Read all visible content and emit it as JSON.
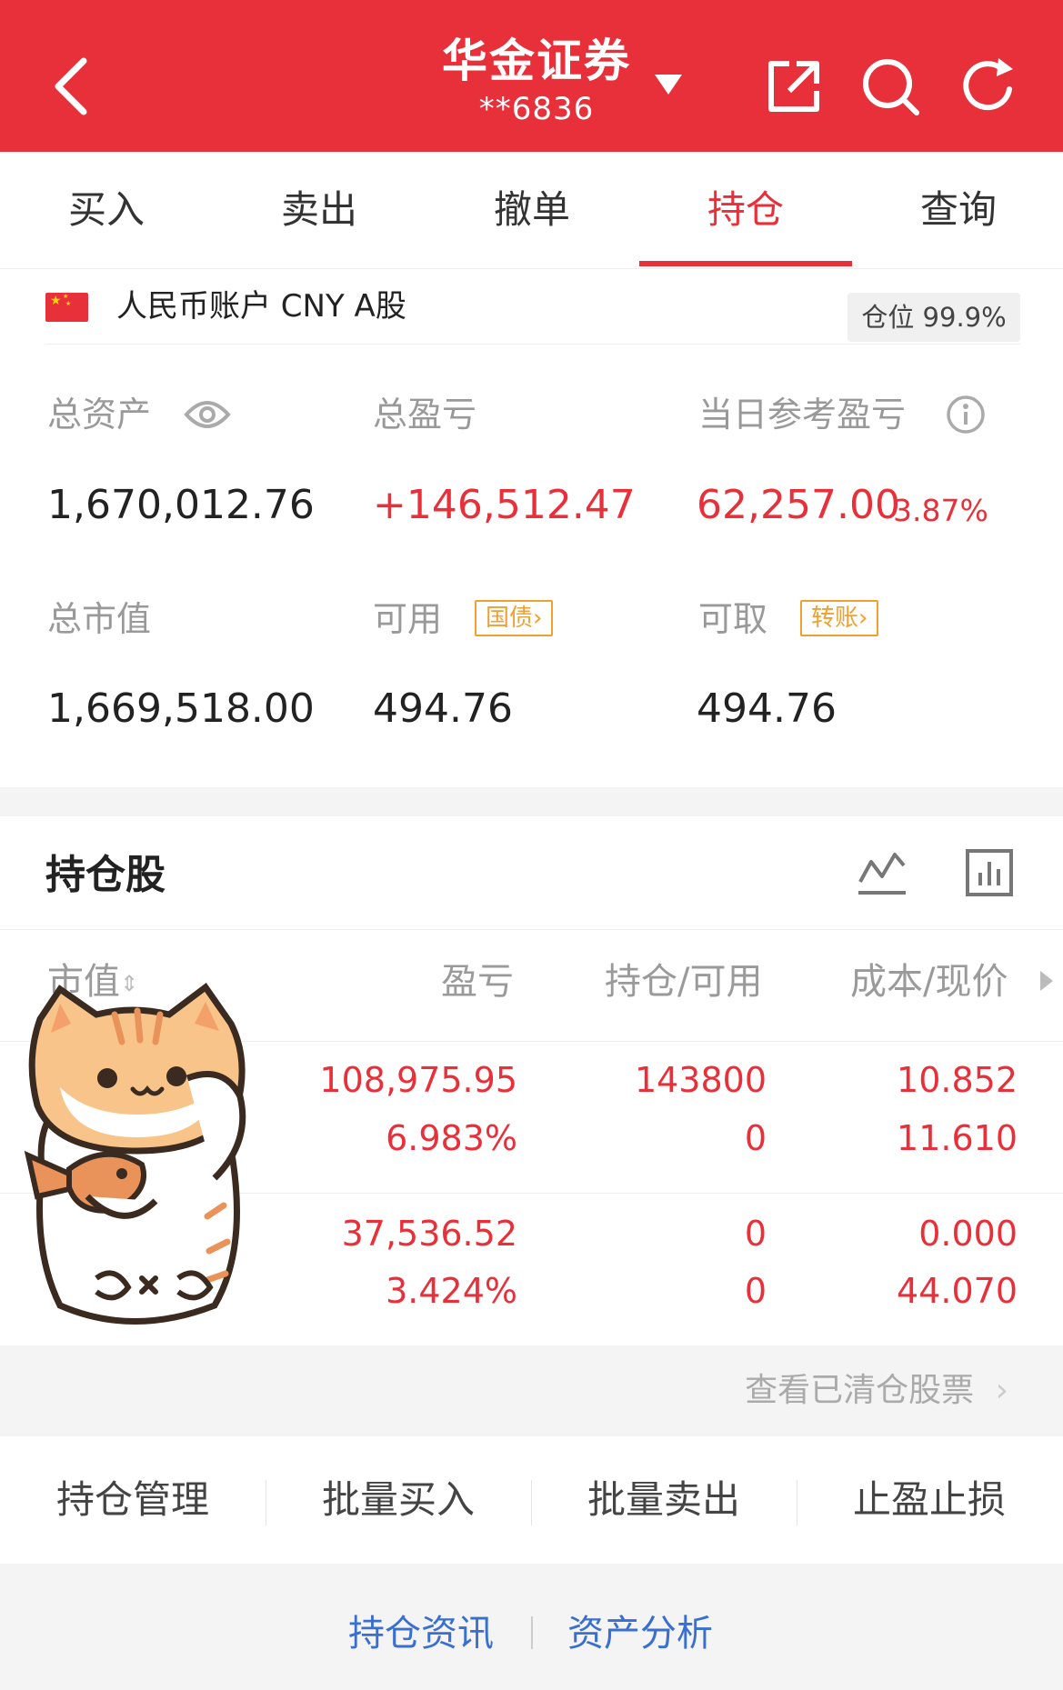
{
  "header": {
    "broker": "华金证券",
    "account_mask": "**6836"
  },
  "tabs": [
    "买入",
    "卖出",
    "撤单",
    "持仓",
    "查询"
  ],
  "active_tab": "持仓",
  "account": {
    "label": "人民币账户 CNY A股",
    "position_label": "仓位",
    "position_value": "99.9%"
  },
  "summary": {
    "total_assets_label": "总资产",
    "total_assets": "1,670,012.76",
    "total_pnl_label": "总盈亏",
    "total_pnl": "+146,512.47",
    "daily_pnl_label": "当日参考盈亏",
    "daily_pnl": "62,257.00",
    "daily_pnl_pct": "3.87%",
    "market_value_label": "总市值",
    "market_value": "1,669,518.00",
    "available_label": "可用",
    "available_tag": "国债",
    "available": "494.76",
    "withdrawable_label": "可取",
    "withdrawable_tag": "转账",
    "withdrawable": "494.76"
  },
  "holdings": {
    "title": "持仓股",
    "columns": [
      "市值",
      "盈亏",
      "持仓/可用",
      "成本/现价"
    ],
    "rows": [
      {
        "pnl": "108,975.95",
        "pnl_pct": "6.983%",
        "hold": "143800",
        "avail": "0",
        "cost": "10.852",
        "price": "11.610"
      },
      {
        "pnl": "37,536.52",
        "pnl_pct": "3.424%",
        "hold": "0",
        "avail": "0",
        "cost": "0.000",
        "price": "44.070"
      }
    ],
    "cleared_link": "查看已清仓股票"
  },
  "actions": [
    "持仓管理",
    "批量买入",
    "批量卖出",
    "止盈止损"
  ],
  "footer": [
    "持仓资讯",
    "资产分析"
  ],
  "colors": {
    "brand_red": "#e8303a",
    "link_blue": "#3a6fd0",
    "tag_orange": "#f0a030"
  }
}
